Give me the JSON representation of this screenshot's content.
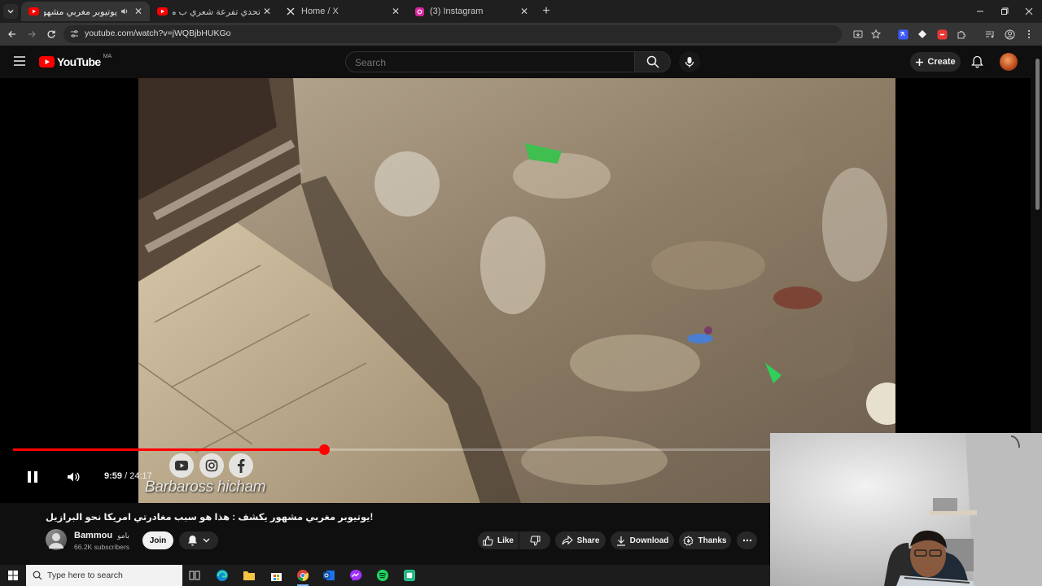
{
  "browser": {
    "tabs": [
      {
        "title": "يوتيوبر مغربي مشهور يكشف",
        "active": true,
        "audio": true,
        "favicon": "youtube-icon"
      },
      {
        "title": "تحدي تفرعة شعري ب ماكينة ديال",
        "active": false,
        "favicon": "youtube-icon"
      },
      {
        "title": "Home / X",
        "active": false,
        "favicon": "x-icon"
      },
      {
        "title": "(3) Instagram",
        "active": false,
        "favicon": "instagram-icon"
      }
    ],
    "close_glyph": "✕",
    "new_tab_glyph": "+",
    "url": "youtube.com/watch?v=jWQBjbHUKGo"
  },
  "youtube": {
    "logo_text": "YouTube",
    "region": "MA",
    "search_placeholder": "Search",
    "create_label": "Create",
    "brand_red": "#ff0000"
  },
  "player": {
    "current_time": "9:59",
    "duration": "24:17",
    "progress_fraction": 0.411,
    "state": "playing",
    "watermark_text": "Barbaross hicham",
    "watermark_icons": [
      "youtube-icon",
      "instagram-icon",
      "facebook-icon"
    ]
  },
  "video": {
    "title": "!يوتيوبر مغربي مشهور يكشف : هذا هو سبب مغادرتي امريكا نحو البرازيل",
    "channel": {
      "name": "Bammou",
      "name_suffix": "بامو",
      "subscribers": "66.2K subscribers",
      "join_label": "Join"
    },
    "actions": {
      "like": "Like",
      "share": "Share",
      "download": "Download",
      "thanks": "Thanks"
    }
  },
  "taskbar": {
    "search_placeholder": "Type here to search",
    "apps": [
      "task-view-icon",
      "edge-icon",
      "file-explorer-icon",
      "store-icon",
      "chrome-icon",
      "outlook-icon",
      "messenger-icon",
      "spotify-icon",
      "app-icon"
    ]
  }
}
